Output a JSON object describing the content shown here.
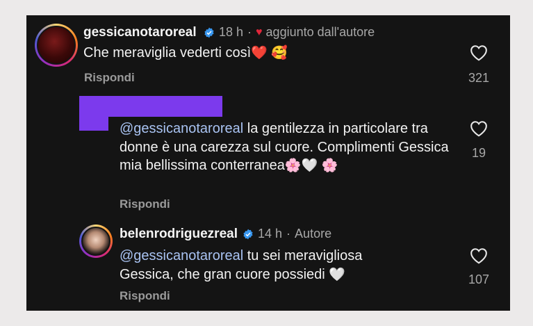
{
  "colors": {
    "mention": "#a9c3f2",
    "verified": "#3897f0",
    "redaction": "#7c3aed",
    "author_heart": "#e0263a"
  },
  "comment1": {
    "username": "gessicanotaroreal",
    "time": "18 h",
    "separator": "·",
    "liked_by_author": "aggiunto dall'autore",
    "text": "Che meraviglia vederti così",
    "emojis": "❤️ 🥰",
    "reply_label": "Rispondi",
    "likes": "321"
  },
  "comment2": {
    "mention": "@gessicanotaroreal",
    "text": " la gentilezza in particolare tra donne è una carezza sul cuore. Complimenti Gessica mia bellissima conterranea",
    "emojis": "🌸🤍 🌸",
    "reply_label": "Rispondi",
    "likes": "19"
  },
  "comment3": {
    "username": "belenrodriguezreal",
    "time": "14 h",
    "separator": "·",
    "author_label": "Autore",
    "mention": "@gessicanotaroreal",
    "text": " tu sei meravigliosa Gessica, che gran cuore possiedi",
    "emojis": "🤍",
    "reply_label": "Rispondi",
    "likes": "107"
  },
  "icons": {
    "like": "heart-outline-icon",
    "verified": "verified-badge-icon"
  }
}
